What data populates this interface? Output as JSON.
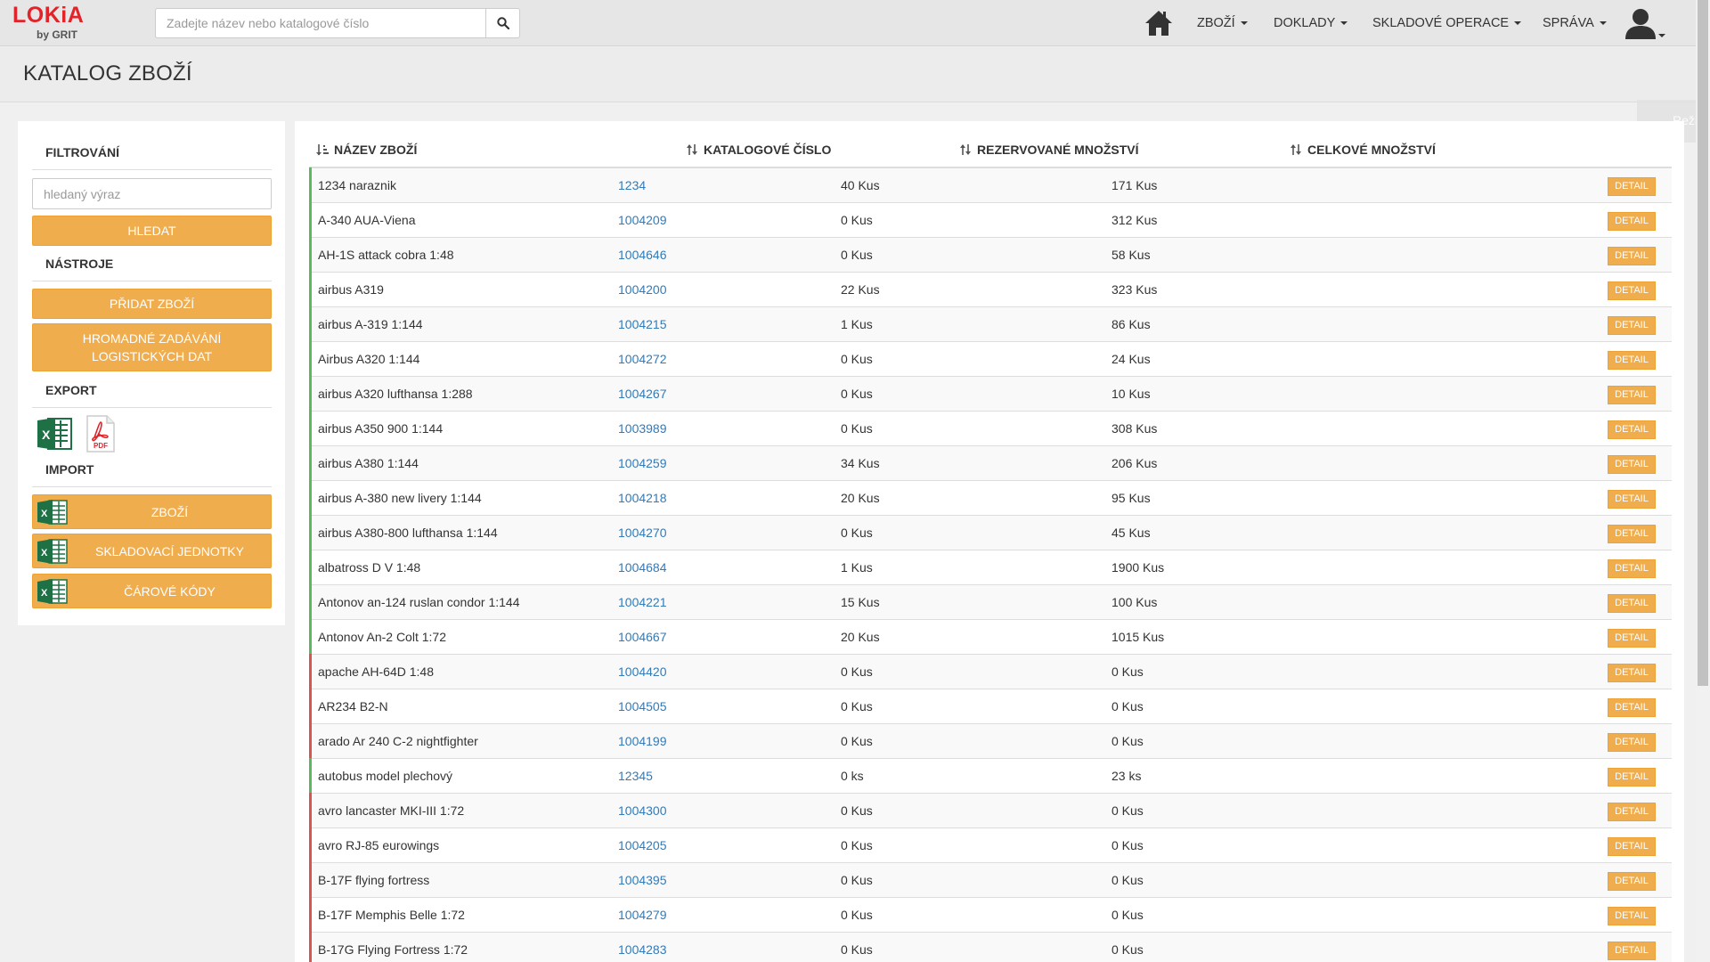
{
  "app": {
    "logo_main": "LOKiA",
    "logo_sub": "by GRIT"
  },
  "search": {
    "placeholder": "Zadejte název nebo katalogové číslo",
    "value": ""
  },
  "nav": {
    "items": [
      {
        "label": "ZBOŽÍ"
      },
      {
        "label": "DOKLADY"
      },
      {
        "label": "SKLADOVÉ OPERACE"
      },
      {
        "label": "SPRÁVA"
      }
    ]
  },
  "page": {
    "title": "KATALOG ZBOŽÍ",
    "mode_tab_label": "Režim"
  },
  "sidebar": {
    "filter_heading": "FILTROVÁNÍ",
    "filter_placeholder": "hledaný výraz",
    "filter_button": "HLEDAT",
    "tools_heading": "NÁSTROJE",
    "add_button": "PŘIDAT ZBOŽÍ",
    "bulk_button_line1": "HROMADNÉ ZADÁVÁNÍ",
    "bulk_button_line2": "LOGISTICKÝCH DAT",
    "export_heading": "EXPORT",
    "export_pdf_label": "PDF",
    "import_heading": "IMPORT",
    "import_buttons": [
      {
        "label": "ZBOŽÍ"
      },
      {
        "label": "SKLADOVACÍ JEDNOTKY"
      },
      {
        "label": "ČÁROVÉ KÓDY"
      }
    ]
  },
  "table": {
    "columns": {
      "name": "NÁZEV ZBOŽÍ",
      "catalog": "KATALOGOVÉ ČÍSLO",
      "reserved": "REZERVOVANÉ MNOŽSTVÍ",
      "total": "CELKOVÉ MNOŽSTVÍ"
    },
    "detail_label": "DETAIL",
    "colors": {
      "in_stock": "#5cb85c",
      "out_of_stock": "#d9534f"
    },
    "rows": [
      {
        "name": "1234 naraznik",
        "catalog": "1234",
        "reserved": "40 Kus",
        "total": "171 Kus",
        "status": "in_stock"
      },
      {
        "name": "A-340 AUA-Viena",
        "catalog": "1004209",
        "reserved": "0 Kus",
        "total": "312 Kus",
        "status": "in_stock"
      },
      {
        "name": "AH-1S attack cobra 1:48",
        "catalog": "1004646",
        "reserved": "0 Kus",
        "total": "58 Kus",
        "status": "in_stock"
      },
      {
        "name": "airbus A319",
        "catalog": "1004200",
        "reserved": "22 Kus",
        "total": "323 Kus",
        "status": "in_stock"
      },
      {
        "name": "airbus A-319 1:144",
        "catalog": "1004215",
        "reserved": "1 Kus",
        "total": "86 Kus",
        "status": "in_stock"
      },
      {
        "name": "Airbus A320 1:144",
        "catalog": "1004272",
        "reserved": "0 Kus",
        "total": "24 Kus",
        "status": "in_stock"
      },
      {
        "name": "airbus A320 lufthansa 1:288",
        "catalog": "1004267",
        "reserved": "0 Kus",
        "total": "10 Kus",
        "status": "in_stock"
      },
      {
        "name": "airbus A350 900 1:144",
        "catalog": "1003989",
        "reserved": "0 Kus",
        "total": "308 Kus",
        "status": "in_stock"
      },
      {
        "name": "airbus A380 1:144",
        "catalog": "1004259",
        "reserved": "34 Kus",
        "total": "206 Kus",
        "status": "in_stock"
      },
      {
        "name": "airbus A-380 new livery 1:144",
        "catalog": "1004218",
        "reserved": "20 Kus",
        "total": "95 Kus",
        "status": "in_stock"
      },
      {
        "name": "airbus A380-800 lufthansa 1:144",
        "catalog": "1004270",
        "reserved": "0 Kus",
        "total": "45 Kus",
        "status": "in_stock"
      },
      {
        "name": "albatross D V 1:48",
        "catalog": "1004684",
        "reserved": "1 Kus",
        "total": "1900 Kus",
        "status": "in_stock"
      },
      {
        "name": "Antonov an-124 ruslan condor 1:144",
        "catalog": "1004221",
        "reserved": "15 Kus",
        "total": "100 Kus",
        "status": "in_stock"
      },
      {
        "name": "Antonov An-2 Colt 1:72",
        "catalog": "1004667",
        "reserved": "20 Kus",
        "total": "1015 Kus",
        "status": "in_stock"
      },
      {
        "name": "apache AH-64D 1:48",
        "catalog": "1004420",
        "reserved": "0 Kus",
        "total": "0 Kus",
        "status": "out_of_stock"
      },
      {
        "name": "AR234 B2-N",
        "catalog": "1004505",
        "reserved": "0 Kus",
        "total": "0 Kus",
        "status": "out_of_stock"
      },
      {
        "name": "arado Ar 240 C-2 nightfighter",
        "catalog": "1004199",
        "reserved": "0 Kus",
        "total": "0 Kus",
        "status": "out_of_stock"
      },
      {
        "name": "autobus model plechový",
        "catalog": "12345",
        "reserved": "0 ks",
        "total": "23 ks",
        "status": "in_stock"
      },
      {
        "name": "avro lancaster MKI-III 1:72",
        "catalog": "1004300",
        "reserved": "0 Kus",
        "total": "0 Kus",
        "status": "out_of_stock"
      },
      {
        "name": "avro RJ-85 eurowings",
        "catalog": "1004205",
        "reserved": "0 Kus",
        "total": "0 Kus",
        "status": "out_of_stock"
      },
      {
        "name": "B-17F flying fortress",
        "catalog": "1004395",
        "reserved": "0 Kus",
        "total": "0 Kus",
        "status": "out_of_stock"
      },
      {
        "name": "B-17F Memphis Belle 1:72",
        "catalog": "1004279",
        "reserved": "0 Kus",
        "total": "0 Kus",
        "status": "out_of_stock"
      },
      {
        "name": "B-17G Flying Fortress 1:72",
        "catalog": "1004283",
        "reserved": "0 Kus",
        "total": "0 Kus",
        "status": "out_of_stock"
      }
    ]
  }
}
